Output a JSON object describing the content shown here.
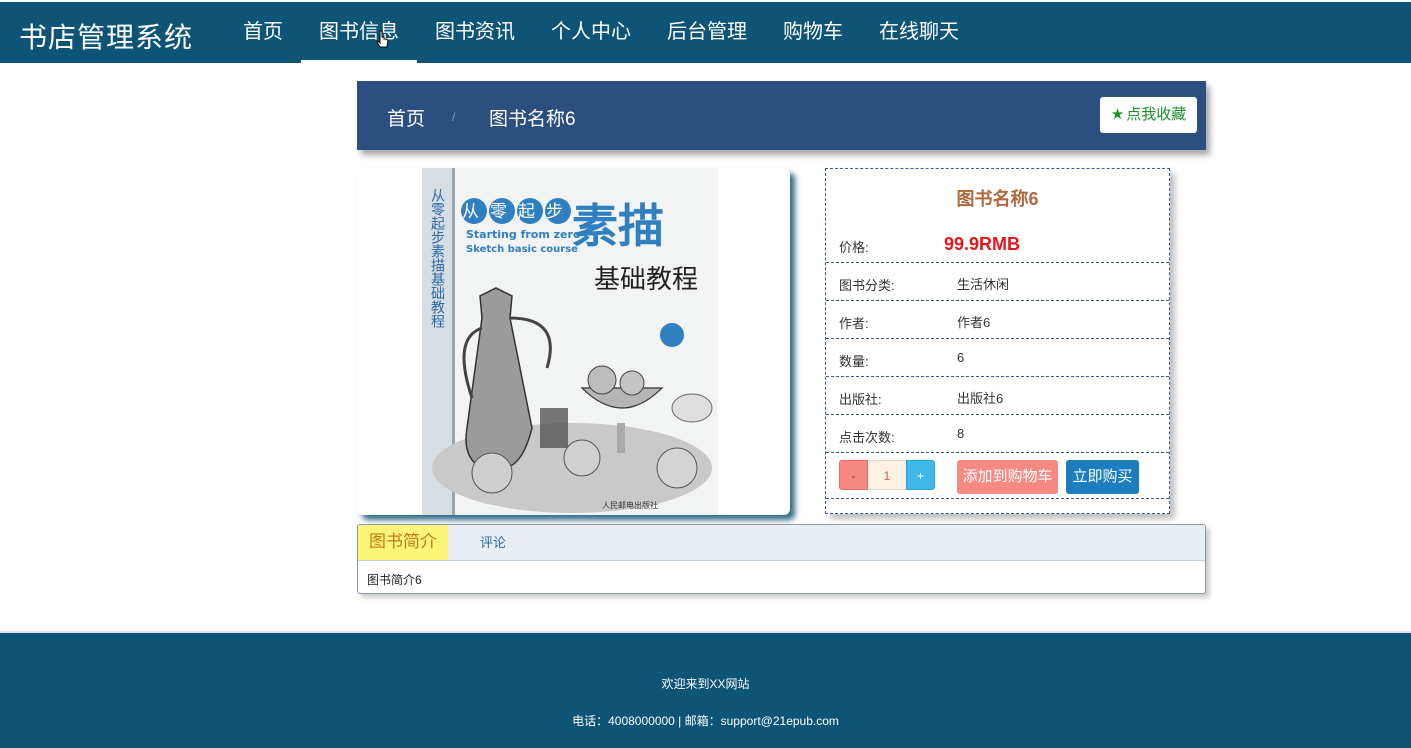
{
  "brand": "书店管理系统",
  "nav": {
    "items": [
      {
        "label": "首页"
      },
      {
        "label": "图书信息"
      },
      {
        "label": "图书资讯"
      },
      {
        "label": "个人中心"
      },
      {
        "label": "后台管理"
      },
      {
        "label": "购物车"
      },
      {
        "label": "在线聊天"
      }
    ],
    "active_index": 1
  },
  "breadcrumb": {
    "home": "首页",
    "separator": "/",
    "current": "图书名称6"
  },
  "favorite_button": {
    "icon": "star-icon",
    "label": "点我收藏"
  },
  "book": {
    "title": "图书名称6",
    "price_label": "价格:",
    "price": "99.9RMB",
    "category_label": "图书分类:",
    "category": "生活休闲",
    "author_label": "作者:",
    "author": "作者6",
    "quantity_label": "数量:",
    "quantity": "6",
    "publisher_label": "出版社:",
    "publisher": "出版社6",
    "clicks_label": "点击次数:",
    "clicks": "8",
    "cover": {
      "main_title": "素描",
      "subtitle": "基础教程",
      "series": "从零起步",
      "en_line1": "Starting from zero",
      "en_line2": "Sketch basic course",
      "spine": "从零起步素描基础教程",
      "publisher": "人民邮电出版社"
    }
  },
  "cart": {
    "minus": "-",
    "qty": "1",
    "plus": "+",
    "add_label": "添加到购物车",
    "buy_label": "立即购买"
  },
  "tabs": {
    "intro_label": "图书简介",
    "comment_label": "评论",
    "intro_text": "图书简介6"
  },
  "footer": {
    "welcome": "欢迎来到XX网站",
    "contact": "电话：4008000000 | 邮箱：support@21epub.com"
  },
  "colors": {
    "primary": "#0d5477",
    "breadcrumb_bg": "#2b4f7f",
    "price": "#e4161b",
    "title": "#b1683e",
    "buy": "#1c7dbf",
    "cart": "#f68a82"
  }
}
